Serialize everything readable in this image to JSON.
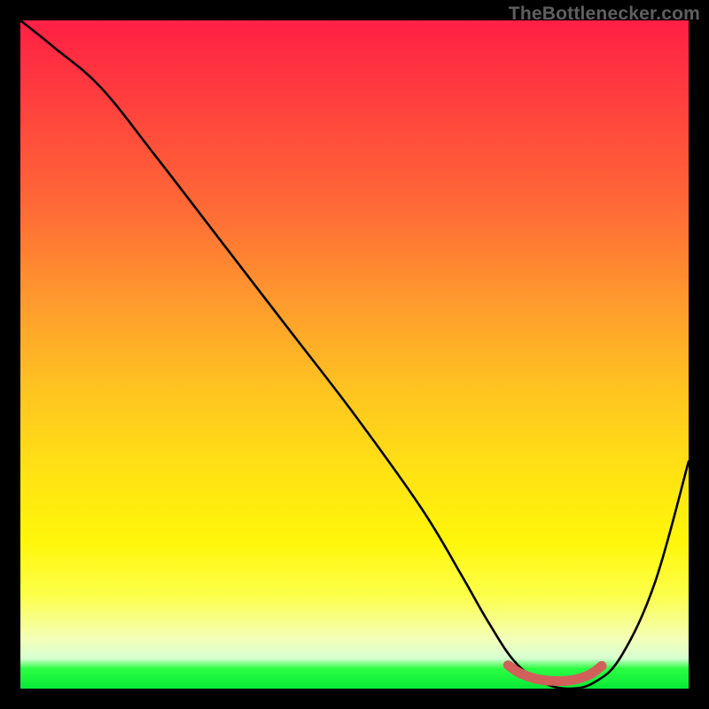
{
  "watermark": "TheBottlenecker.com",
  "chart_data": {
    "type": "line",
    "title": "",
    "xlabel": "",
    "ylabel": "",
    "xlim": [
      0,
      100
    ],
    "ylim": [
      0,
      100
    ],
    "series": [
      {
        "name": "bottleneck-curve",
        "x": [
          0,
          5,
          12,
          20,
          30,
          40,
          50,
          60,
          66,
          70,
          74,
          78,
          82,
          86,
          90,
          95,
          100
        ],
        "values": [
          100,
          96,
          90,
          80,
          67,
          54,
          41,
          27,
          17,
          10,
          4,
          1,
          0,
          1,
          5,
          16,
          34
        ]
      },
      {
        "name": "trough-marker",
        "x": [
          73,
          75,
          78,
          82,
          85,
          87
        ],
        "values": [
          3.5,
          2.2,
          1.3,
          1.2,
          2.0,
          3.4
        ]
      }
    ],
    "colors": {
      "curve": "#000000",
      "marker": "#d1605a",
      "gradient_stops": [
        "#ff1f45",
        "#ff6a36",
        "#ffc321",
        "#fff60a",
        "#f4ffb8",
        "#07e838"
      ]
    }
  }
}
